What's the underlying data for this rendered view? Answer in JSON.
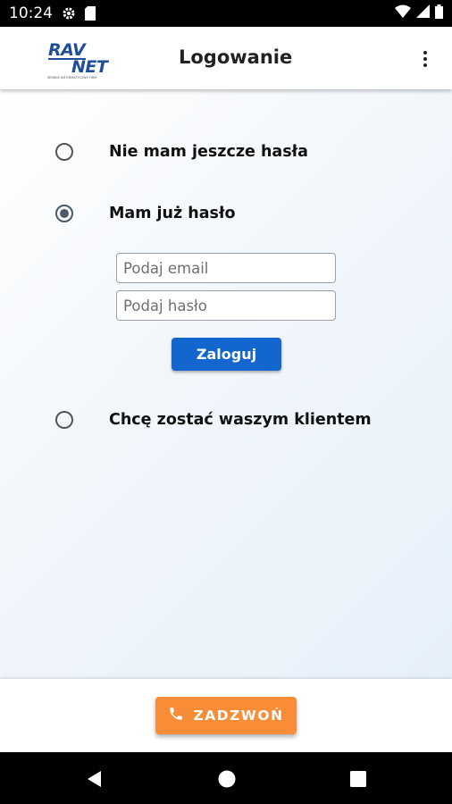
{
  "status_bar": {
    "time": "10:24",
    "icons_left": [
      "gear-icon",
      "sd-card-icon"
    ],
    "icons_right": [
      "wifi-icon",
      "cell-signal-icon",
      "battery-icon"
    ]
  },
  "app_bar": {
    "logo_text_top": "RAV",
    "logo_text_bottom": "NET",
    "logo_tagline": "SERWIS INFORMATYCZNY FIRM",
    "title": "Logowanie",
    "menu_icon": "more-vertical-icon"
  },
  "login_options": [
    {
      "label": "Nie mam jeszcze hasła",
      "checked": false
    },
    {
      "label": "Mam już hasło",
      "checked": true
    },
    {
      "label": "Chcę zostać waszym klientem",
      "checked": false
    }
  ],
  "form": {
    "email_placeholder": "Podaj email",
    "email_value": "",
    "password_placeholder": "Podaj hasło",
    "password_value": "",
    "login_button": "Zaloguj"
  },
  "call_button": {
    "label": "ZADZWOŃ",
    "icon": "phone-icon"
  },
  "colors": {
    "primary_button": "#1466cf",
    "call_button": "#f98c36",
    "logo_blue": "#1f4e9b"
  },
  "nav_bar": {
    "buttons": [
      "back-icon",
      "home-icon",
      "recents-icon"
    ]
  }
}
